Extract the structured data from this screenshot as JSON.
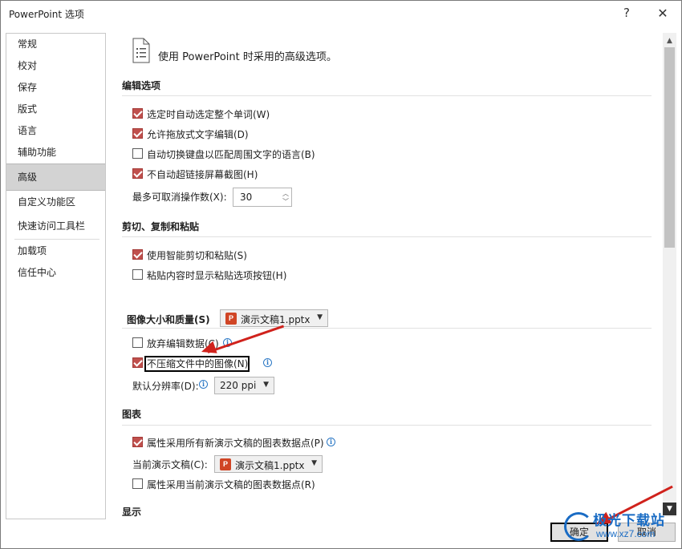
{
  "window": {
    "title": "PowerPoint 选项",
    "help": "?",
    "close": "✕"
  },
  "nav": {
    "items": [
      {
        "label": "常规"
      },
      {
        "label": "校对"
      },
      {
        "label": "保存"
      },
      {
        "label": "版式"
      },
      {
        "label": "语言"
      },
      {
        "label": "辅助功能"
      },
      {
        "label": "高级",
        "selected": true
      },
      {
        "label": "自定义功能区"
      },
      {
        "label": "快速访问工具栏"
      },
      {
        "label": "加载项"
      },
      {
        "label": "信任中心"
      }
    ]
  },
  "content": {
    "header": "使用 PowerPoint 时采用的高级选项。",
    "editing": {
      "title": "编辑选项",
      "options": [
        {
          "label": "选定时自动选定整个单词(W)",
          "checked": true
        },
        {
          "label": "允许拖放式文字编辑(D)",
          "checked": true
        },
        {
          "label": "自动切换键盘以匹配周围文字的语言(B)",
          "checked": false
        },
        {
          "label": "不自动超链接屏幕截图(H)",
          "checked": true
        }
      ],
      "undo_label": "最多可取消操作数(X):",
      "undo_value": "30"
    },
    "clipboard": {
      "title": "剪切、复制和粘贴",
      "options": [
        {
          "label": "使用智能剪切和粘贴(S)",
          "checked": true
        },
        {
          "label": "粘贴内容时显示粘贴选项按钮(H)",
          "checked": false
        }
      ]
    },
    "image": {
      "title": "图像大小和质量(S)",
      "document": "演示文稿1.pptx",
      "options": [
        {
          "label": "放弃编辑数据(C)",
          "checked": false
        },
        {
          "label": "不压缩文件中的图像(N)",
          "checked": true
        }
      ],
      "resolution_label": "默认分辨率(D):",
      "resolution_value": "220 ppi"
    },
    "chart": {
      "title": "图表",
      "options": [
        {
          "label": "属性采用所有新演示文稿的图表数据点(P)",
          "checked": true
        },
        {
          "label": "属性采用当前演示文稿的图表数据点(R)",
          "checked": false
        }
      ],
      "current_label": "当前演示文稿(C):",
      "current_document": "演示文稿1.pptx"
    },
    "display": {
      "title": "显示"
    }
  },
  "buttons": {
    "ok": "确定",
    "cancel": "取消"
  },
  "icons": {
    "ppt": "P",
    "info": "i"
  },
  "watermark": {
    "text": "极光下载站",
    "url": "www.xz7.com"
  },
  "colors": {
    "accent": "#c0504d",
    "selected_nav": "#d3d3d3",
    "arrow": "#d0221c"
  }
}
